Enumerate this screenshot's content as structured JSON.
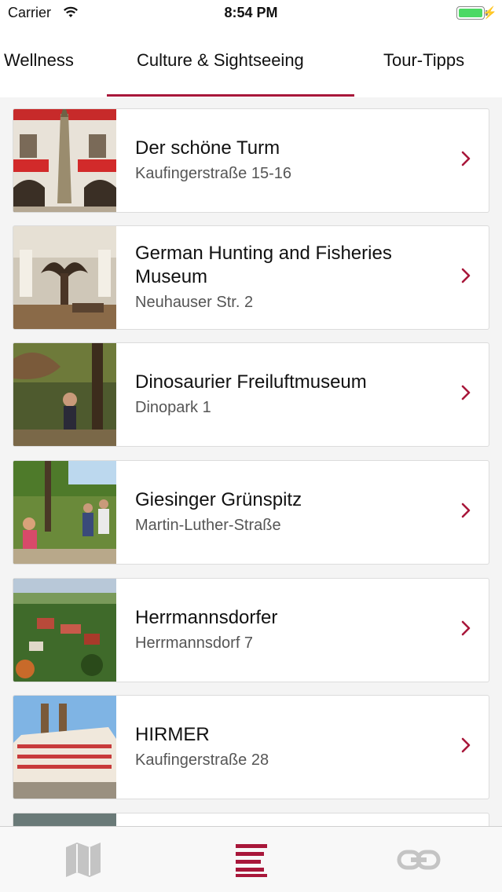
{
  "status_bar": {
    "carrier": "Carrier",
    "time": "8:54 PM"
  },
  "tabs": [
    {
      "label": "Wellness",
      "selected": false
    },
    {
      "label": "Culture & Sightseeing",
      "selected": true
    },
    {
      "label": "Tour-Tipps",
      "selected": false
    }
  ],
  "accent_color": "#a8173a",
  "list": [
    {
      "title": "Der schöne Turm",
      "subtitle": "Kaufingerstraße 15-16",
      "thumb": "tower-facade-photo"
    },
    {
      "title": "German Hunting and Fisheries Museum",
      "subtitle": "Neuhauser Str. 2",
      "thumb": "museum-interior-photo"
    },
    {
      "title": "Dinosaurier Freiluftmuseum",
      "subtitle": "Dinopark 1",
      "thumb": "dinopark-photo"
    },
    {
      "title": "Giesinger Grünspitz",
      "subtitle": "Martin-Luther-Straße",
      "thumb": "park-crowd-photo"
    },
    {
      "title": "Herrmannsdorfer",
      "subtitle": "Herrmannsdorf 7",
      "thumb": "aerial-village-photo"
    },
    {
      "title": "HIRMER",
      "subtitle": "Kaufingerstraße 28",
      "thumb": "hirmer-building-photo"
    }
  ],
  "tabbar": [
    {
      "icon": "map-icon",
      "selected": false
    },
    {
      "icon": "list-icon",
      "selected": true
    },
    {
      "icon": "link-icon",
      "selected": false
    }
  ]
}
